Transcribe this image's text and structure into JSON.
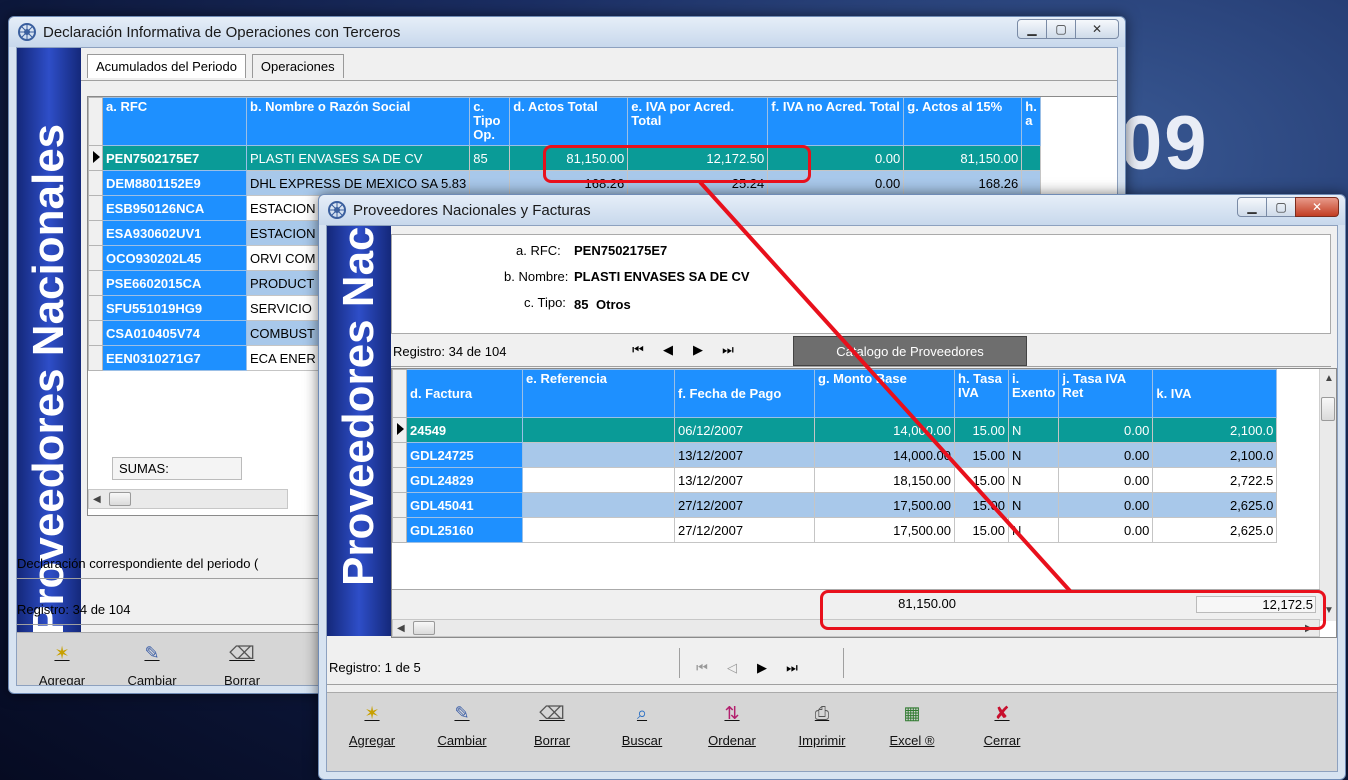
{
  "background_text": "09",
  "window1": {
    "title": "Declaración Informativa de Operaciones con Terceros",
    "banner": "Proveedores Nacionales",
    "tabs": [
      {
        "label": "Acumulados del Periodo"
      },
      {
        "label": "Operaciones"
      }
    ],
    "columns": [
      {
        "label": "a. RFC"
      },
      {
        "label": "b. Nombre o Razón Social"
      },
      {
        "label": "c. Tipo Op."
      },
      {
        "label": "d. Actos Total"
      },
      {
        "label": "e. IVA por Acred. Total"
      },
      {
        "label": "f. IVA no Acred. Total"
      },
      {
        "label": "g. Actos al 15%"
      },
      {
        "label": "h. a"
      }
    ],
    "rows": [
      {
        "rfc": "PEN7502175E7",
        "nombre": "PLASTI ENVASES SA DE CV",
        "tipo": "85",
        "actos": "81,150.00",
        "iva_acred": "12,172.50",
        "iva_no": "0.00",
        "actos15": "81,150.00"
      },
      {
        "rfc": "DEM8801152E9",
        "nombre": "DHL EXPRESS DE MEXICO SA 5.83",
        "tipo": "",
        "actos": "168.26",
        "iva_acred": "25.24",
        "iva_no": "0.00",
        "actos15": "168.26"
      },
      {
        "rfc": "ESB950126NCA",
        "nombre": "ESTACION",
        "tipo": "",
        "actos": "",
        "iva_acred": "",
        "iva_no": "",
        "actos15": ""
      },
      {
        "rfc": "ESA930602UV1",
        "nombre": "ESTACION",
        "tipo": "",
        "actos": "",
        "iva_acred": "",
        "iva_no": "",
        "actos15": ""
      },
      {
        "rfc": "OCO930202L45",
        "nombre": "ORVI COM",
        "tipo": "",
        "actos": "",
        "iva_acred": "",
        "iva_no": "",
        "actos15": ""
      },
      {
        "rfc": "PSE6602015CA",
        "nombre": "PRODUCT",
        "tipo": "",
        "actos": "",
        "iva_acred": "",
        "iva_no": "",
        "actos15": ""
      },
      {
        "rfc": "SFU551019HG9",
        "nombre": "SERVICIO",
        "tipo": "",
        "actos": "",
        "iva_acred": "",
        "iva_no": "",
        "actos15": ""
      },
      {
        "rfc": "CSA010405V74",
        "nombre": "COMBUST",
        "tipo": "",
        "actos": "",
        "iva_acred": "",
        "iva_no": "",
        "actos15": ""
      },
      {
        "rfc": "EEN0310271G7",
        "nombre": "ECA ENER",
        "tipo": "",
        "actos": "",
        "iva_acred": "",
        "iva_no": "",
        "actos15": ""
      }
    ],
    "sumas_label": "SUMAS:",
    "declaracion_text": "Declaración correspondiente del periodo (",
    "registro": "Registro: 34 de 104",
    "toolbar": [
      {
        "label": "Agregar",
        "icon": "sparkle-icon"
      },
      {
        "label": "Cambiar",
        "icon": "edit-icon"
      },
      {
        "label": "Borrar",
        "icon": "eraser-icon"
      }
    ]
  },
  "window2": {
    "title": "Proveedores Nacionales y Facturas",
    "banner": "Proveedores Nacionales",
    "info": {
      "rfc_label": "a. RFC:",
      "rfc_value": "PEN7502175E7",
      "nombre_label": "b. Nombre:",
      "nombre_value": "PLASTI ENVASES SA DE CV",
      "tipo_label": "c. Tipo:",
      "tipo_code": "85",
      "tipo_value": "Otros"
    },
    "registro_top": "Registro: 34 de 104",
    "catalogo_tab": "Catalogo de Proveedores",
    "columns": [
      {
        "label": "d. Factura"
      },
      {
        "label": "e. Referencia"
      },
      {
        "label": "f. Fecha de Pago"
      },
      {
        "label": "g. Monto Base"
      },
      {
        "label": "h. Tasa IVA"
      },
      {
        "label": "i. Exento"
      },
      {
        "label": "j. Tasa IVA Ret"
      },
      {
        "label": "k. IVA"
      }
    ],
    "rows": [
      {
        "factura": "24549",
        "ref": "",
        "fecha": "06/12/2007",
        "monto": "14,000.00",
        "tasa": "15.00",
        "exento": "N",
        "ret": "0.00",
        "iva": "2,100.0"
      },
      {
        "factura": "GDL24725",
        "ref": "",
        "fecha": "13/12/2007",
        "monto": "14,000.00",
        "tasa": "15.00",
        "exento": "N",
        "ret": "0.00",
        "iva": "2,100.0"
      },
      {
        "factura": "GDL24829",
        "ref": "",
        "fecha": "13/12/2007",
        "monto": "18,150.00",
        "tasa": "15.00",
        "exento": "N",
        "ret": "0.00",
        "iva": "2,722.5"
      },
      {
        "factura": "GDL45041",
        "ref": "",
        "fecha": "27/12/2007",
        "monto": "17,500.00",
        "tasa": "15.00",
        "exento": "N",
        "ret": "0.00",
        "iva": "2,625.0"
      },
      {
        "factura": "GDL25160",
        "ref": "",
        "fecha": "27/12/2007",
        "monto": "17,500.00",
        "tasa": "15.00",
        "exento": "N",
        "ret": "0.00",
        "iva": "2,625.0"
      }
    ],
    "total_monto": "81,150.00",
    "total_iva": "12,172.5",
    "registro_bottom": "Registro: 1 de 5",
    "toolbar": [
      {
        "label": "Agregar",
        "icon": "sparkle-icon"
      },
      {
        "label": "Cambiar",
        "icon": "edit-icon"
      },
      {
        "label": "Borrar",
        "icon": "eraser-icon"
      },
      {
        "label": "Buscar",
        "icon": "search-icon"
      },
      {
        "label": "Ordenar",
        "icon": "sort-icon"
      },
      {
        "label": "Imprimir",
        "icon": "printer-icon"
      },
      {
        "label": "Excel ®",
        "icon": "excel-icon"
      },
      {
        "label": "Cerrar",
        "icon": "close-icon"
      }
    ]
  },
  "colors": {
    "header_blue": "#1e90ff",
    "selected_teal": "#0a9b97",
    "alt_row": "#a8c8ea",
    "annotation_red": "#e8101c"
  }
}
